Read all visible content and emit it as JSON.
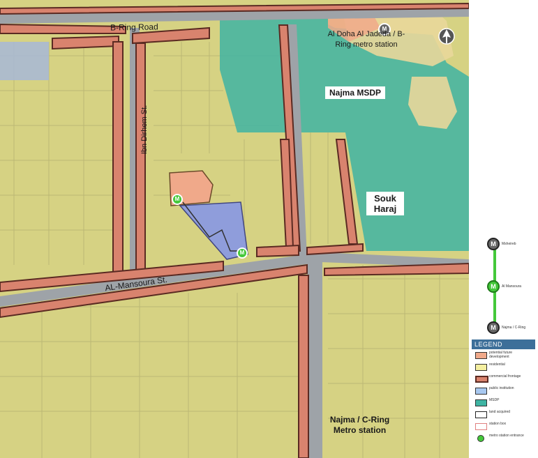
{
  "map": {
    "labels": {
      "b_ring_road": "B-Ring Road",
      "ibn_dirhem": "Ibn Dirhem St.",
      "al_mansoura": "AL-Mansoura St.",
      "al_doha": "Al Doha Al Jadeda / B-Ring metro station",
      "najma_msdp": "Najma MSDP",
      "souk_haraj": "Souk Haraj",
      "najma_c_ring": "Najma / C-Ring Metro station"
    },
    "station_marker": "M",
    "colors": {
      "residential": "#d9d480",
      "msdp": "#3fb4a3",
      "commercial": "#d9836e",
      "public_institution": "#8c9be0",
      "future_development": "#f0a98a",
      "road": "#9ea3a8"
    }
  },
  "metro_line": {
    "stations": [
      {
        "label": "Msheireb",
        "marker": "M"
      },
      {
        "label": "Al Mansoura",
        "marker": "M"
      },
      {
        "label": "Najma / C-Ring",
        "marker": "M"
      }
    ],
    "line_color": "#44c83a"
  },
  "legend": {
    "title": "LEGEND",
    "items": [
      {
        "label": "potential future development",
        "color": "#f0a98a"
      },
      {
        "label": "residential",
        "color": "#f4efa0"
      },
      {
        "label": "commercial frontage",
        "color": "#d9836e"
      },
      {
        "label": "public institution",
        "color": "#a8c8f0"
      },
      {
        "label": "MSDP",
        "color": "#3fb4a3"
      },
      {
        "label": "land acquired",
        "color": "#ffffff"
      },
      {
        "label": "station box",
        "color": "#ffffff"
      },
      {
        "label": "metro station entrance",
        "color": "#44c83a"
      }
    ]
  }
}
